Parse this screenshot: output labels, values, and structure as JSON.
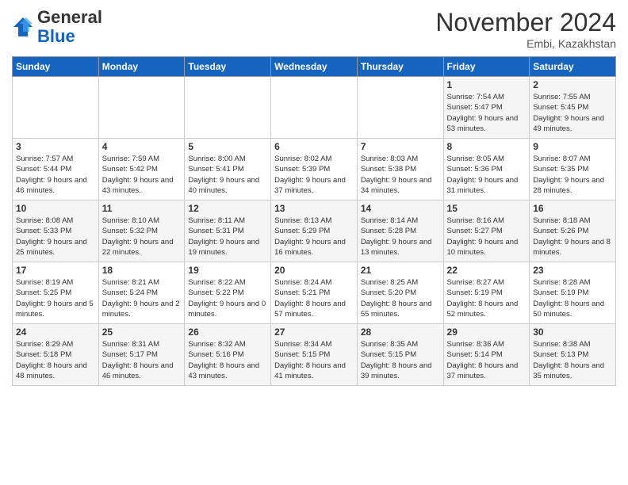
{
  "logo": {
    "general": "General",
    "blue": "Blue"
  },
  "header": {
    "month": "November 2024",
    "location": "Embi, Kazakhstan"
  },
  "weekdays": [
    "Sunday",
    "Monday",
    "Tuesday",
    "Wednesday",
    "Thursday",
    "Friday",
    "Saturday"
  ],
  "weeks": [
    [
      {
        "day": "",
        "info": ""
      },
      {
        "day": "",
        "info": ""
      },
      {
        "day": "",
        "info": ""
      },
      {
        "day": "",
        "info": ""
      },
      {
        "day": "",
        "info": ""
      },
      {
        "day": "1",
        "info": "Sunrise: 7:54 AM\nSunset: 5:47 PM\nDaylight: 9 hours and 53 minutes."
      },
      {
        "day": "2",
        "info": "Sunrise: 7:55 AM\nSunset: 5:45 PM\nDaylight: 9 hours and 49 minutes."
      }
    ],
    [
      {
        "day": "3",
        "info": "Sunrise: 7:57 AM\nSunset: 5:44 PM\nDaylight: 9 hours and 46 minutes."
      },
      {
        "day": "4",
        "info": "Sunrise: 7:59 AM\nSunset: 5:42 PM\nDaylight: 9 hours and 43 minutes."
      },
      {
        "day": "5",
        "info": "Sunrise: 8:00 AM\nSunset: 5:41 PM\nDaylight: 9 hours and 40 minutes."
      },
      {
        "day": "6",
        "info": "Sunrise: 8:02 AM\nSunset: 5:39 PM\nDaylight: 9 hours and 37 minutes."
      },
      {
        "day": "7",
        "info": "Sunrise: 8:03 AM\nSunset: 5:38 PM\nDaylight: 9 hours and 34 minutes."
      },
      {
        "day": "8",
        "info": "Sunrise: 8:05 AM\nSunset: 5:36 PM\nDaylight: 9 hours and 31 minutes."
      },
      {
        "day": "9",
        "info": "Sunrise: 8:07 AM\nSunset: 5:35 PM\nDaylight: 9 hours and 28 minutes."
      }
    ],
    [
      {
        "day": "10",
        "info": "Sunrise: 8:08 AM\nSunset: 5:33 PM\nDaylight: 9 hours and 25 minutes."
      },
      {
        "day": "11",
        "info": "Sunrise: 8:10 AM\nSunset: 5:32 PM\nDaylight: 9 hours and 22 minutes."
      },
      {
        "day": "12",
        "info": "Sunrise: 8:11 AM\nSunset: 5:31 PM\nDaylight: 9 hours and 19 minutes."
      },
      {
        "day": "13",
        "info": "Sunrise: 8:13 AM\nSunset: 5:29 PM\nDaylight: 9 hours and 16 minutes."
      },
      {
        "day": "14",
        "info": "Sunrise: 8:14 AM\nSunset: 5:28 PM\nDaylight: 9 hours and 13 minutes."
      },
      {
        "day": "15",
        "info": "Sunrise: 8:16 AM\nSunset: 5:27 PM\nDaylight: 9 hours and 10 minutes."
      },
      {
        "day": "16",
        "info": "Sunrise: 8:18 AM\nSunset: 5:26 PM\nDaylight: 9 hours and 8 minutes."
      }
    ],
    [
      {
        "day": "17",
        "info": "Sunrise: 8:19 AM\nSunset: 5:25 PM\nDaylight: 9 hours and 5 minutes."
      },
      {
        "day": "18",
        "info": "Sunrise: 8:21 AM\nSunset: 5:24 PM\nDaylight: 9 hours and 2 minutes."
      },
      {
        "day": "19",
        "info": "Sunrise: 8:22 AM\nSunset: 5:22 PM\nDaylight: 9 hours and 0 minutes."
      },
      {
        "day": "20",
        "info": "Sunrise: 8:24 AM\nSunset: 5:21 PM\nDaylight: 8 hours and 57 minutes."
      },
      {
        "day": "21",
        "info": "Sunrise: 8:25 AM\nSunset: 5:20 PM\nDaylight: 8 hours and 55 minutes."
      },
      {
        "day": "22",
        "info": "Sunrise: 8:27 AM\nSunset: 5:19 PM\nDaylight: 8 hours and 52 minutes."
      },
      {
        "day": "23",
        "info": "Sunrise: 8:28 AM\nSunset: 5:19 PM\nDaylight: 8 hours and 50 minutes."
      }
    ],
    [
      {
        "day": "24",
        "info": "Sunrise: 8:29 AM\nSunset: 5:18 PM\nDaylight: 8 hours and 48 minutes."
      },
      {
        "day": "25",
        "info": "Sunrise: 8:31 AM\nSunset: 5:17 PM\nDaylight: 8 hours and 46 minutes."
      },
      {
        "day": "26",
        "info": "Sunrise: 8:32 AM\nSunset: 5:16 PM\nDaylight: 8 hours and 43 minutes."
      },
      {
        "day": "27",
        "info": "Sunrise: 8:34 AM\nSunset: 5:15 PM\nDaylight: 8 hours and 41 minutes."
      },
      {
        "day": "28",
        "info": "Sunrise: 8:35 AM\nSunset: 5:15 PM\nDaylight: 8 hours and 39 minutes."
      },
      {
        "day": "29",
        "info": "Sunrise: 8:36 AM\nSunset: 5:14 PM\nDaylight: 8 hours and 37 minutes."
      },
      {
        "day": "30",
        "info": "Sunrise: 8:38 AM\nSunset: 5:13 PM\nDaylight: 8 hours and 35 minutes."
      }
    ]
  ]
}
